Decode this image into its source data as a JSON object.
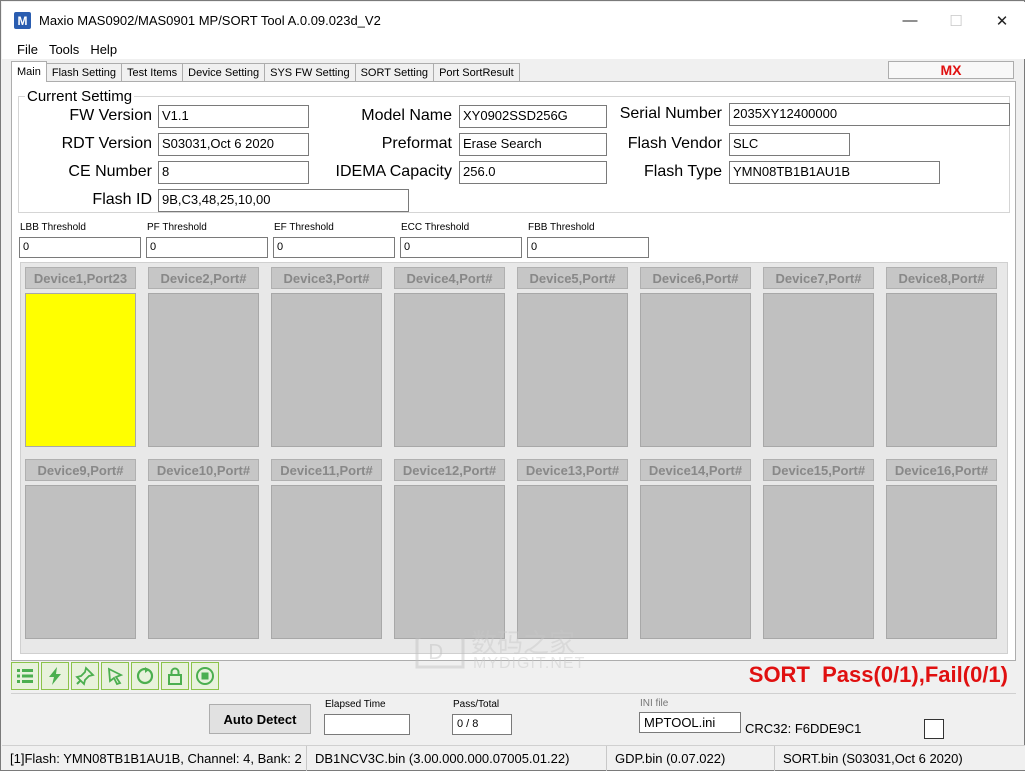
{
  "window": {
    "title": "Maxio MAS0902/MAS0901 MP/SORT Tool A.0.09.023d_V2",
    "icon_letter": "M",
    "controls": {
      "minimize": "—",
      "maximize": "☐",
      "close": "✕"
    }
  },
  "menu": [
    "File",
    "Tools",
    "Help"
  ],
  "tabs": [
    "Main",
    "Flash Setting",
    "Test Items",
    "Device Setting",
    "SYS FW Setting",
    "SORT Setting",
    "Port SortResult"
  ],
  "brand_tag": "MX",
  "current_setting": {
    "legend": "Current Settimg",
    "fw_version": {
      "label": "FW Version",
      "value": "V1.1"
    },
    "rdt_version": {
      "label": "RDT Version",
      "value": "S03031,Oct  6 2020"
    },
    "ce_number": {
      "label": "CE Number",
      "value": "8"
    },
    "flash_id": {
      "label": "Flash ID",
      "value": "9B,C3,48,25,10,00"
    },
    "model_name": {
      "label": "Model Name",
      "value": "XY0902SSD256G"
    },
    "preformat": {
      "label": "Preformat",
      "value": "Erase Search"
    },
    "idema_capacity": {
      "label": "IDEMA Capacity",
      "value": "256.0"
    },
    "serial_number": {
      "label": "Serial Number",
      "value": "2035XY12400000"
    },
    "flash_vendor": {
      "label": "Flash Vendor",
      "value": "SLC"
    },
    "flash_type": {
      "label": "Flash Type",
      "value": "YMN08TB1B1AU1B"
    }
  },
  "thresholds": [
    {
      "label": "LBB Threshold",
      "value": "0"
    },
    {
      "label": "PF Threshold",
      "value": "0"
    },
    {
      "label": "EF Threshold",
      "value": "0"
    },
    {
      "label": "ECC Threshold",
      "value": "0"
    },
    {
      "label": "FBB Threshold",
      "value": "0"
    }
  ],
  "devices": [
    {
      "label": "Device1,Port23",
      "state": "active",
      "color": "#ffff00"
    },
    {
      "label": "Device2,Port#",
      "state": "idle"
    },
    {
      "label": "Device3,Port#",
      "state": "idle"
    },
    {
      "label": "Device4,Port#",
      "state": "idle"
    },
    {
      "label": "Device5,Port#",
      "state": "idle"
    },
    {
      "label": "Device6,Port#",
      "state": "idle"
    },
    {
      "label": "Device7,Port#",
      "state": "idle"
    },
    {
      "label": "Device8,Port#",
      "state": "idle"
    },
    {
      "label": "Device9,Port#",
      "state": "idle"
    },
    {
      "label": "Device10,Port#",
      "state": "idle"
    },
    {
      "label": "Device11,Port#",
      "state": "idle"
    },
    {
      "label": "Device12,Port#",
      "state": "idle"
    },
    {
      "label": "Device13,Port#",
      "state": "idle"
    },
    {
      "label": "Device14,Port#",
      "state": "idle"
    },
    {
      "label": "Device15,Port#",
      "state": "idle"
    },
    {
      "label": "Device16,Port#",
      "state": "idle"
    }
  ],
  "toolbar": {
    "icons": [
      "list-icon",
      "lightning-icon",
      "pin-icon",
      "cursor-icon",
      "refresh-icon",
      "lock-icon",
      "stop-icon"
    ]
  },
  "sort_status": {
    "mode": "SORT",
    "summary": "Pass(0/1),Fail(0/1)",
    "color": "#e01010"
  },
  "bottom": {
    "auto_detect": "Auto Detect",
    "elapsed_label": "Elapsed Time",
    "elapsed_value": "",
    "pass_total_label": "Pass/Total",
    "pass_total_value": "0 / 8",
    "ini_label": "INI file",
    "ini_value": "MPTOOL.ini",
    "crc": "CRC32: F6DDE9C1"
  },
  "statusbar": [
    "[1]Flash: YMN08TB1B1AU1B, Channel: 4, Bank: 2",
    "DB1NCV3C.bin (3.00.000.000.07005.01.22)",
    "GDP.bin (0.07.022)",
    "SORT.bin (S03031,Oct  6 2020)"
  ],
  "watermark": {
    "cn": "数码之家",
    "en": "MYDIGIT.NET"
  }
}
